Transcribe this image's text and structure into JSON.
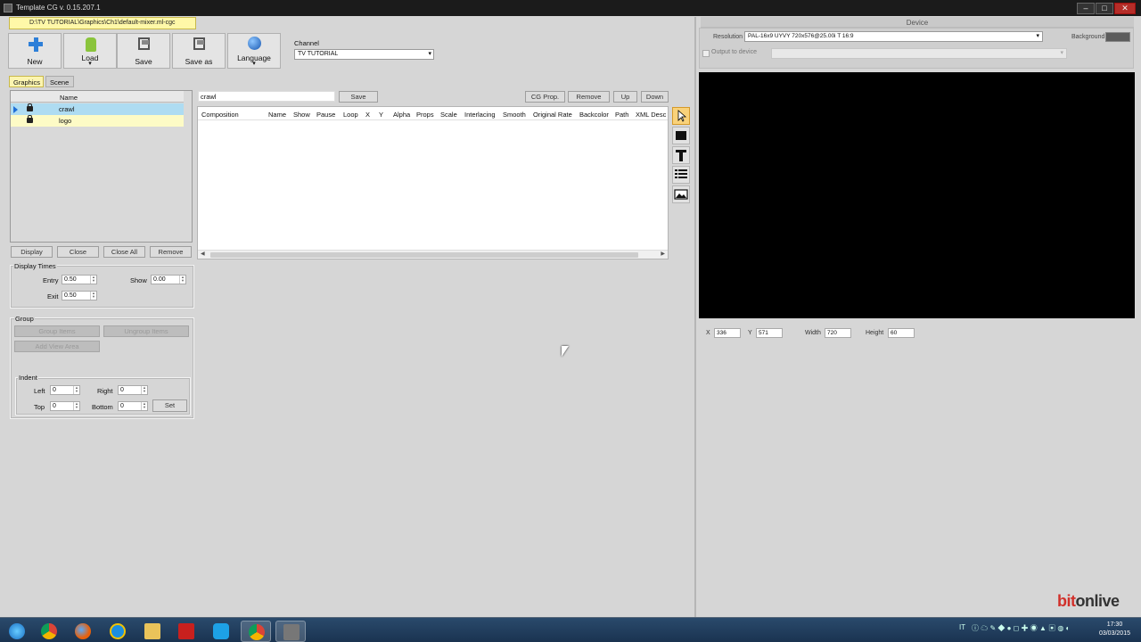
{
  "window": {
    "title": "Template CG v. 0.15.207.1",
    "path_tab": "D:\\TV TUTORIAL\\Graphics\\Ch1\\default-mixer.ml-cgc"
  },
  "toolbar": {
    "new_label": "New",
    "load_label": "Load",
    "save_label": "Save",
    "saveas_label": "Save as",
    "language_label": "Language"
  },
  "channel": {
    "label": "Channel",
    "value": "TV TUTORIAL"
  },
  "device": {
    "title": "Device",
    "resolution_label": "Resolution",
    "resolution_value": "PAL-16x9 UYVY 720x576@25.00i T 16:9",
    "background_label": "Background",
    "background_color": "#5c5c5c",
    "output_label": "Output to device"
  },
  "geometry": {
    "x_label": "X",
    "x_value": "336",
    "y_label": "Y",
    "y_value": "571",
    "width_label": "Width",
    "width_value": "720",
    "height_label": "Height",
    "height_value": "60"
  },
  "tabs": [
    {
      "label": "Graphics",
      "active": true
    },
    {
      "label": "Scene",
      "active": false
    }
  ],
  "layers": {
    "header_name": "Name",
    "items": [
      {
        "name": "crawl",
        "selected": true
      },
      {
        "name": "logo",
        "selected": false
      }
    ]
  },
  "layer_buttons": {
    "display": "Display",
    "close": "Close",
    "close_all": "Close All",
    "remove": "Remove"
  },
  "display_times": {
    "title": "Display Times",
    "entry_label": "Entry",
    "entry_value": "0.50",
    "show_label": "Show",
    "show_value": "0.00",
    "exit_label": "Exit",
    "exit_value": "0.50"
  },
  "group": {
    "title": "Group",
    "group_items": "Group Items",
    "ungroup_items": "Ungroup Items",
    "add_view_area": "Add View Area"
  },
  "indent": {
    "title": "Indent",
    "left_label": "Left",
    "left_value": "0",
    "right_label": "Right",
    "right_value": "0",
    "top_label": "Top",
    "top_value": "0",
    "bottom_label": "Bottom",
    "bottom_value": "0",
    "set_label": "Set"
  },
  "composition": {
    "name_value": "crawl",
    "save_label": "Save",
    "cgprop_label": "CG Prop.",
    "remove_label": "Remove",
    "up_label": "Up",
    "down_label": "Down",
    "columns": [
      "Composition",
      "Name",
      "Show",
      "Pause",
      "Loop",
      "X",
      "Y",
      "Alpha",
      "Props",
      "Scale",
      "Interlacing",
      "Smooth",
      "Original Rate",
      "Backcolor",
      "Path",
      "XML Desc"
    ]
  },
  "tools": [
    "pointer-icon",
    "rectangle-icon",
    "text-icon",
    "list-icon",
    "image-icon"
  ],
  "taskbar": {
    "clock_time": "17:30",
    "clock_date": "03/03/2015",
    "lang": "IT"
  },
  "brand": {
    "part1": "bit",
    "part2": "onlive"
  }
}
